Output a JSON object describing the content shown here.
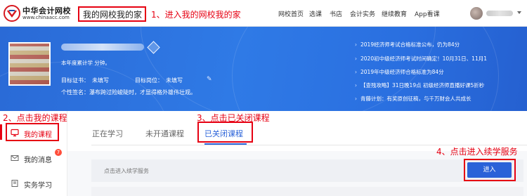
{
  "header": {
    "logo_cn": "中华会计网校",
    "logo_en": "www.chinaacc.com",
    "home_label": "我的网校我的家",
    "nav": [
      "网校首页",
      "选课",
      "书店",
      "会计实务",
      "继续教育",
      "App看课"
    ]
  },
  "annotations": {
    "step1": "1、进入我的网校我的家",
    "step2": "2、点击我的课程",
    "step3": "3、点击已关闭课程",
    "step4": "4、点击进入续学服务"
  },
  "profile": {
    "study_line": "本年度累计学  分钟。",
    "cert_label": "目标证书：",
    "cert_value": "未填写",
    "post_label": "目标岗位：",
    "post_value": "未填写",
    "signature": "个性签名：瀑布跨过险峻陡时，才显得格外雄伟壮观。"
  },
  "notices": [
    "2019经济师考试合格标准公布，仍为84分",
    "2020初中级经济师考试时间确定！10月31日、11月1",
    "2019年中级经济师合格标准为84分",
    "【查残攻略】31日晚19点 初级经济师直播好课5折秒",
    "青藤计划：有奖原创征稿，与千万财会人共成长"
  ],
  "sidebar": {
    "items": [
      {
        "label": "我的课程",
        "icon": "monitor-icon",
        "active": true
      },
      {
        "label": "我的消息",
        "icon": "mail-icon",
        "badge": "7"
      },
      {
        "label": "实务学习",
        "icon": "book-icon"
      }
    ]
  },
  "tabs": [
    "正在学习",
    "未开通课程",
    "已关闭课程"
  ],
  "course_row": {
    "text": "点击进入续学服务",
    "button": "进入"
  },
  "colors": {
    "accent": "#2a62d8",
    "annotation": "#e60012",
    "banner": "#2f7ae6"
  }
}
